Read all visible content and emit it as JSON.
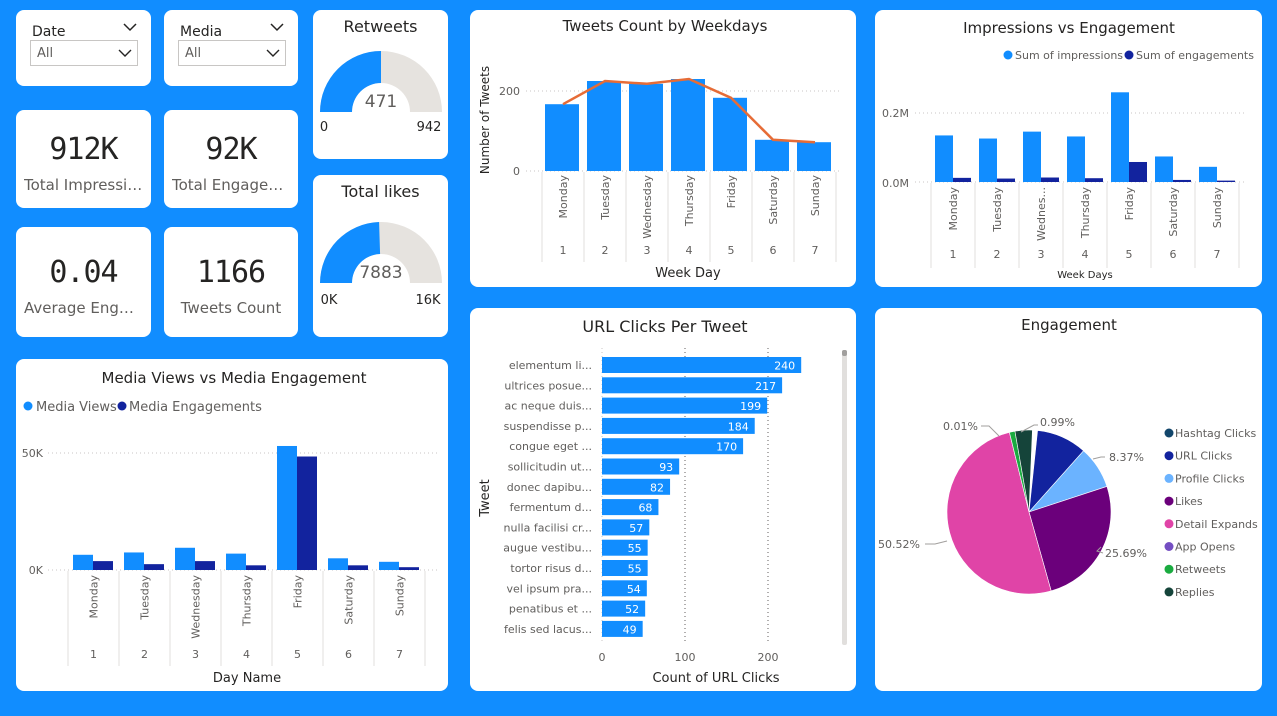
{
  "slicers": {
    "date": {
      "title": "Date",
      "value": "All"
    },
    "media": {
      "title": "Media",
      "value": "All"
    }
  },
  "kpis": {
    "impressions": {
      "value": "912K",
      "label": "Total Impressio..."
    },
    "engagements": {
      "value": "92K",
      "label": "Total Engagem..."
    },
    "avg_engagement": {
      "value": "0.04",
      "label": "Average Engag..."
    },
    "tweets_count": {
      "value": "1166",
      "label": "Tweets Count"
    }
  },
  "gauges": {
    "retweets": {
      "title": "Retweets",
      "value": 471,
      "value_label": "471",
      "min_label": "0",
      "max_label": "942",
      "fraction": 0.5
    },
    "likes": {
      "title": "Total likes",
      "value": 7883,
      "value_label": "7883",
      "min_label": "0K",
      "max_label": "16K",
      "fraction": 0.49
    }
  },
  "colors": {
    "accent": "#118DFF",
    "dark_blue": "#12239E",
    "orange": "#E66C37",
    "gauge_bg": "#E6E3DF"
  },
  "chart_data": [
    {
      "id": "tweets_by_weekday",
      "type": "bar",
      "title": "Tweets Count by Weekdays",
      "xlabel": "Week Day",
      "ylabel": "Number of Tweets",
      "categories": [
        "Monday",
        "Tuesday",
        "Wednesday",
        "Thursday",
        "Friday",
        "Saturday",
        "Sunday"
      ],
      "sub_categories": [
        "1",
        "2",
        "3",
        "4",
        "5",
        "6",
        "7"
      ],
      "values": [
        167,
        225,
        218,
        230,
        183,
        78,
        72
      ],
      "line_values": [
        167,
        225,
        218,
        230,
        183,
        78,
        72
      ],
      "yticks": [
        "0",
        "200"
      ],
      "ylim": [
        0,
        260
      ]
    },
    {
      "id": "impressions_vs_engagement",
      "type": "bar",
      "title": "Impressions vs Engagement",
      "xlabel": "Week Days",
      "categories": [
        "Monday",
        "Tuesday",
        "Wednes...",
        "Thursday",
        "Friday",
        "Saturday",
        "Sunday"
      ],
      "sub_categories": [
        "1",
        "2",
        "3",
        "4",
        "5",
        "6",
        "7"
      ],
      "series": [
        {
          "name": "Sum of impressions",
          "values": [
            0.135,
            0.126,
            0.146,
            0.132,
            0.26,
            0.074,
            0.044
          ]
        },
        {
          "name": "Sum of engagements",
          "values": [
            0.012,
            0.01,
            0.013,
            0.011,
            0.058,
            0.006,
            0.004
          ]
        }
      ],
      "yticks": [
        "0.0M",
        "0.2M"
      ],
      "ylim": [
        0,
        0.3
      ]
    },
    {
      "id": "url_clicks",
      "type": "bar",
      "orientation": "horizontal",
      "title": "URL Clicks Per Tweet",
      "xlabel": "Count of URL Clicks",
      "ylabel": "Tweet",
      "categories": [
        "elementum li...",
        "ultrices posue...",
        "ac neque duis...",
        "suspendisse p...",
        "congue eget ...",
        "sollicitudin ut...",
        "donec dapibu...",
        "fermentum d...",
        "nulla facilisi cr...",
        "augue vestibu...",
        "tortor risus d...",
        "vel ipsum pra...",
        "penatibus et ...",
        "felis sed lacus..."
      ],
      "values": [
        240,
        217,
        199,
        184,
        170,
        93,
        82,
        68,
        57,
        55,
        55,
        54,
        52,
        49
      ],
      "value_labels": [
        "240",
        "217",
        "199",
        "184",
        "170",
        "93",
        "82",
        "68",
        "57",
        "55",
        "55",
        "54",
        "52",
        "49"
      ],
      "xticks": [
        "0",
        "100",
        "200"
      ],
      "xlim": [
        0,
        245
      ]
    },
    {
      "id": "engagement_pie",
      "type": "pie",
      "title": "Engagement",
      "slices": [
        {
          "name": "Hashtag Clicks",
          "color": "#12466B",
          "share": 0.0
        },
        {
          "name": "URL Clicks",
          "color": "#12239E",
          "share": 0.0991
        },
        {
          "name": "Profile Clicks",
          "color": "#6BB3FF",
          "share": 0.0837
        },
        {
          "name": "Likes",
          "color": "#6B007B",
          "share": 0.2569
        },
        {
          "name": "Detail Expands",
          "color": "#E044A7",
          "share": 0.5052
        },
        {
          "name": "App Opens",
          "color": "#744EC2",
          "share": 0.0001
        },
        {
          "name": "Retweets",
          "color": "#1AAB40",
          "share": 0.011
        },
        {
          "name": "Replies",
          "color": "#15443A",
          "share": 0.034
        }
      ],
      "slice_labels": [
        "0.99%",
        "8.37%",
        "25.69%",
        "50.52%",
        "0.01%"
      ]
    },
    {
      "id": "media_views_vs_engagement",
      "type": "bar",
      "title": "Media Views vs Media Engagement",
      "xlabel": "Day Name",
      "categories": [
        "Monday",
        "Tuesday",
        "Wednesday",
        "Thursday",
        "Friday",
        "Saturday",
        "Sunday"
      ],
      "sub_categories": [
        "1",
        "2",
        "3",
        "4",
        "5",
        "6",
        "7"
      ],
      "series": [
        {
          "name": "Media Views",
          "values": [
            6.5,
            7.5,
            9.5,
            7,
            53,
            5,
            3.5
          ]
        },
        {
          "name": "Media Engagements",
          "values": [
            3.8,
            2.5,
            3.8,
            2,
            48.5,
            2,
            1.2
          ]
        }
      ],
      "yticks": [
        "0K",
        "50K"
      ],
      "ylim": [
        0,
        55
      ]
    }
  ]
}
